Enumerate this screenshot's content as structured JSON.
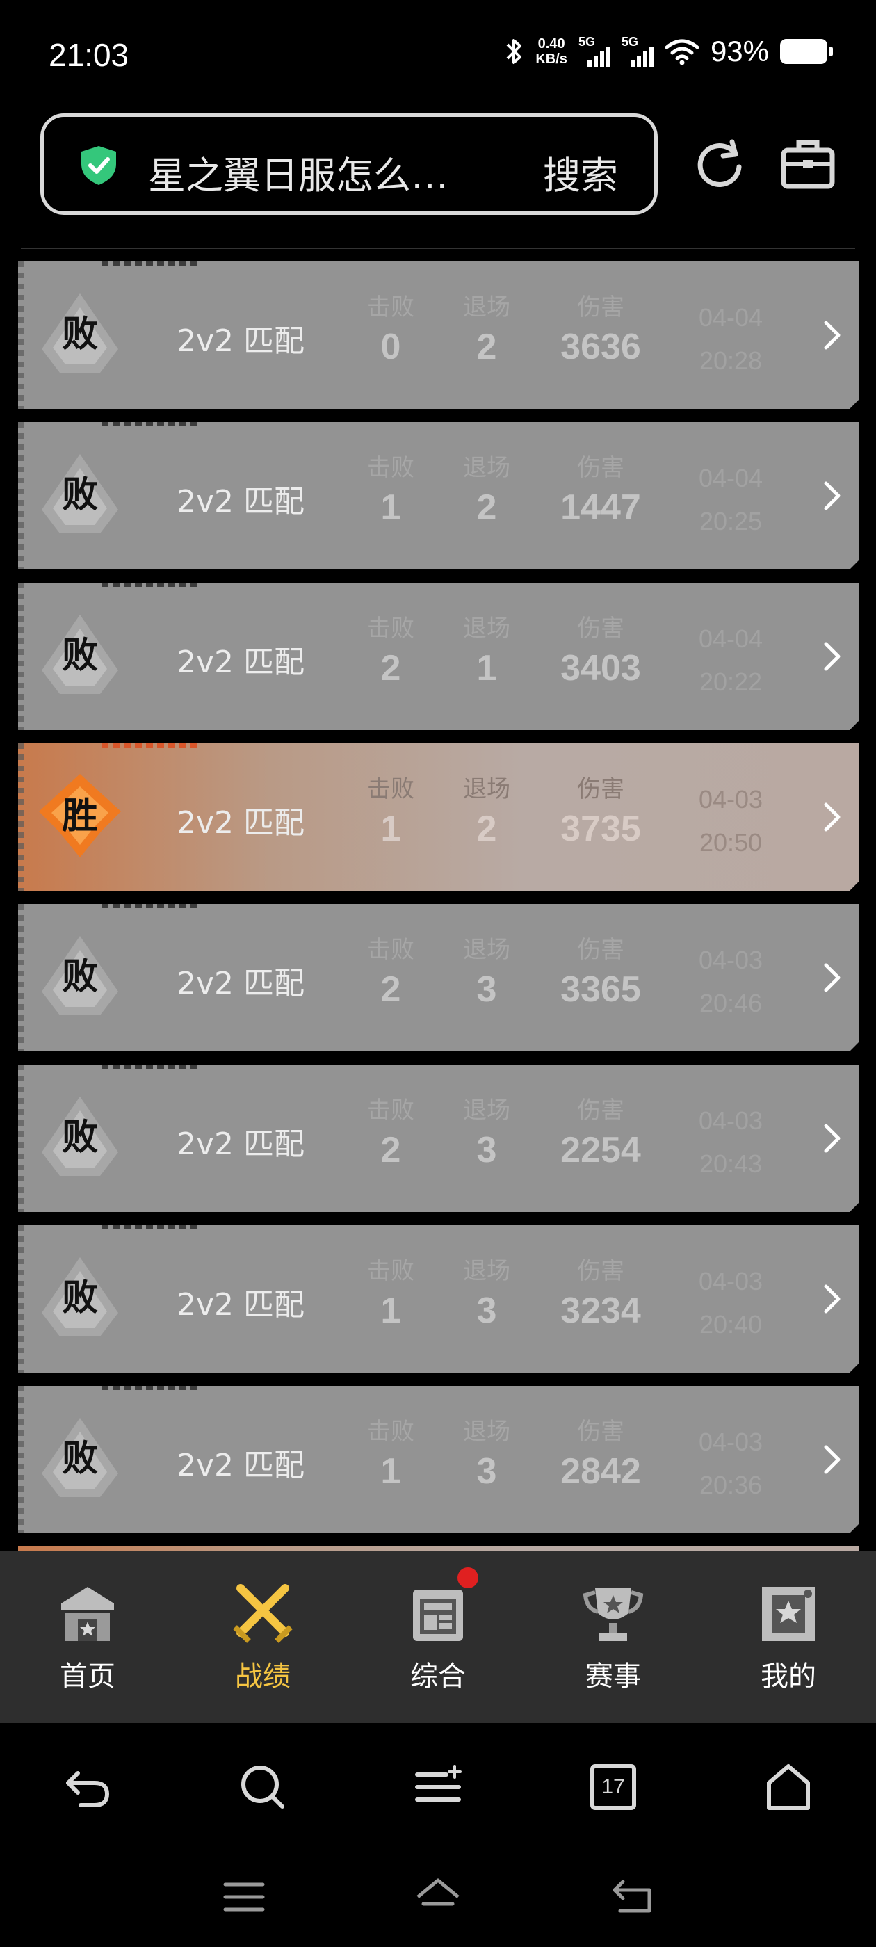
{
  "status_bar": {
    "time": "21:03",
    "net_speed_value": "0.40",
    "net_speed_unit": "KB/s",
    "sim1_label": "5G",
    "sim2_label": "5G",
    "battery": "93%",
    "icons": [
      "bluetooth-icon",
      "signal-icon",
      "wifi-icon",
      "battery-icon"
    ]
  },
  "header": {
    "search_text": "星之翼日服怎么…",
    "search_button": "搜索",
    "shield_color": "#34c77b"
  },
  "records": [
    {
      "result": "败",
      "mode": "2v2 匹配",
      "kills_label": "击败",
      "kills": "0",
      "exits_label": "退场",
      "exits": "2",
      "damage_label": "伤害",
      "damage": "3636",
      "date": "04-04",
      "time": "20:28",
      "win": false
    },
    {
      "result": "败",
      "mode": "2v2 匹配",
      "kills_label": "击败",
      "kills": "1",
      "exits_label": "退场",
      "exits": "2",
      "damage_label": "伤害",
      "damage": "1447",
      "date": "04-04",
      "time": "20:25",
      "win": false
    },
    {
      "result": "败",
      "mode": "2v2 匹配",
      "kills_label": "击败",
      "kills": "2",
      "exits_label": "退场",
      "exits": "1",
      "damage_label": "伤害",
      "damage": "3403",
      "date": "04-04",
      "time": "20:22",
      "win": false
    },
    {
      "result": "胜",
      "mode": "2v2 匹配",
      "kills_label": "击败",
      "kills": "1",
      "exits_label": "退场",
      "exits": "2",
      "damage_label": "伤害",
      "damage": "3735",
      "date": "04-03",
      "time": "20:50",
      "win": true
    },
    {
      "result": "败",
      "mode": "2v2 匹配",
      "kills_label": "击败",
      "kills": "2",
      "exits_label": "退场",
      "exits": "3",
      "damage_label": "伤害",
      "damage": "3365",
      "date": "04-03",
      "time": "20:46",
      "win": false
    },
    {
      "result": "败",
      "mode": "2v2 匹配",
      "kills_label": "击败",
      "kills": "2",
      "exits_label": "退场",
      "exits": "3",
      "damage_label": "伤害",
      "damage": "2254",
      "date": "04-03",
      "time": "20:43",
      "win": false
    },
    {
      "result": "败",
      "mode": "2v2 匹配",
      "kills_label": "击败",
      "kills": "1",
      "exits_label": "退场",
      "exits": "3",
      "damage_label": "伤害",
      "damage": "3234",
      "date": "04-03",
      "time": "20:40",
      "win": false
    },
    {
      "result": "败",
      "mode": "2v2 匹配",
      "kills_label": "击败",
      "kills": "1",
      "exits_label": "退场",
      "exits": "3",
      "damage_label": "伤害",
      "damage": "2842",
      "date": "04-03",
      "time": "20:36",
      "win": false
    }
  ],
  "tabbar": {
    "items": [
      {
        "label": "首页",
        "icon": "home-gate-icon",
        "active": false
      },
      {
        "label": "战绩",
        "icon": "crossed-swords-icon",
        "active": true
      },
      {
        "label": "综合",
        "icon": "news-panel-icon",
        "active": false,
        "has_dot": true
      },
      {
        "label": "赛事",
        "icon": "trophy-icon",
        "active": false
      },
      {
        "label": "我的",
        "icon": "profile-card-icon",
        "active": false
      }
    ],
    "active_color": "#f5c542"
  },
  "browser_bar": {
    "tab_count": "17",
    "icons": [
      "back-icon",
      "search-icon",
      "menu-icon",
      "tabs-icon",
      "home-icon"
    ]
  },
  "system_nav": {
    "icons": [
      "recents-icon",
      "home-icon",
      "back-icon"
    ]
  }
}
